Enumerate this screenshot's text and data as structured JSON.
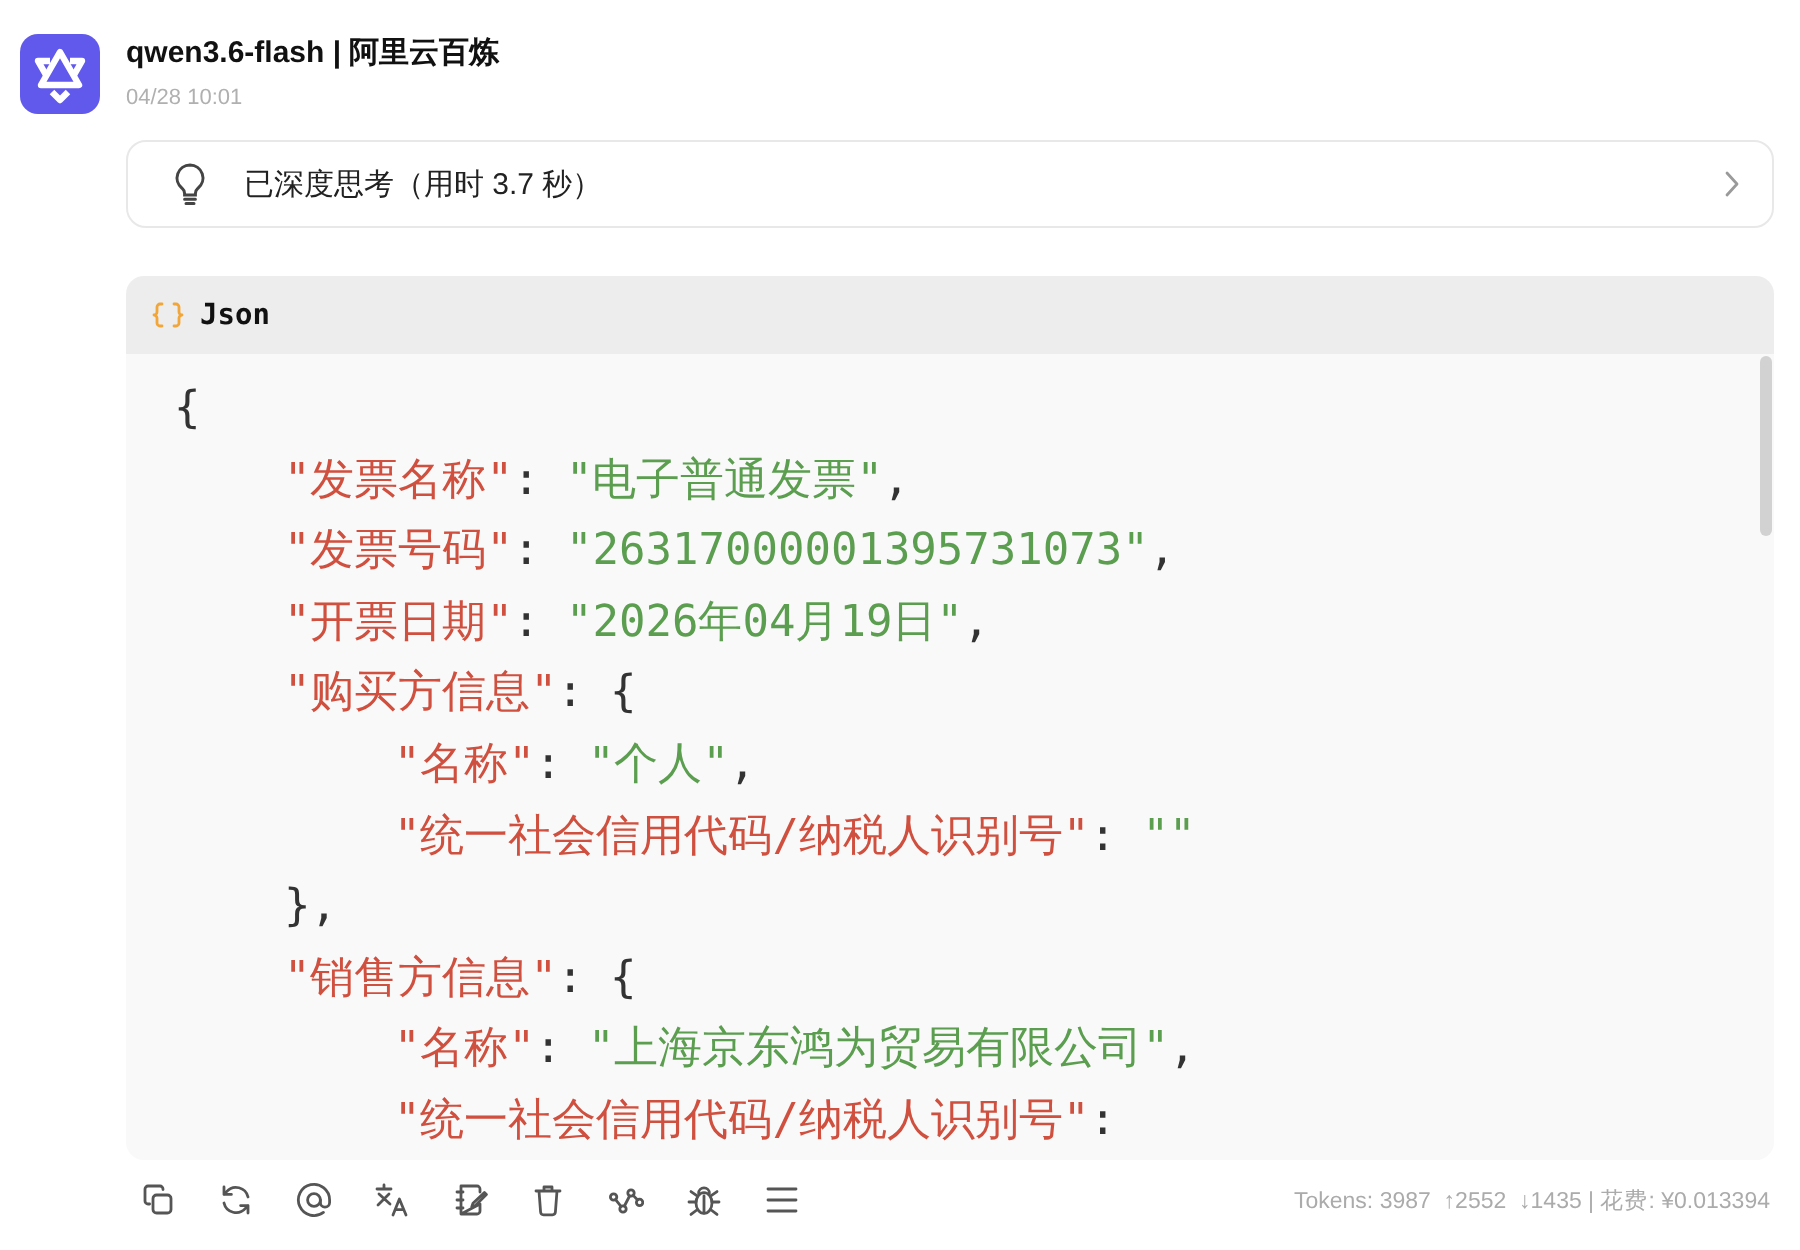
{
  "header": {
    "title": "qwen3.6-flash | 阿里云百炼",
    "time": "04/28 10:01"
  },
  "thinking": {
    "label": "已深度思考（用时 3.7 秒）",
    "expanded": false
  },
  "code_block": {
    "language": "Json",
    "lines": [
      {
        "tokens": [
          {
            "kind": "punct",
            "text": "{"
          }
        ],
        "children": [
          {
            "tokens": [
              {
                "kind": "key",
                "text": "\"发票名称\""
              },
              {
                "kind": "punct",
                "text": ": "
              },
              {
                "kind": "string",
                "text": "\"电子普通发票\""
              },
              {
                "kind": "punct",
                "text": ","
              }
            ]
          },
          {
            "tokens": [
              {
                "kind": "key",
                "text": "\"发票号码\""
              },
              {
                "kind": "punct",
                "text": ": "
              },
              {
                "kind": "string",
                "text": "\"26317000001395731073\""
              },
              {
                "kind": "punct",
                "text": ","
              }
            ]
          },
          {
            "tokens": [
              {
                "kind": "key",
                "text": "\"开票日期\""
              },
              {
                "kind": "punct",
                "text": ": "
              },
              {
                "kind": "string",
                "text": "\"2026年04月19日\""
              },
              {
                "kind": "punct",
                "text": ","
              }
            ]
          },
          {
            "tokens": [
              {
                "kind": "key",
                "text": "\"购买方信息\""
              },
              {
                "kind": "punct",
                "text": ": {"
              }
            ],
            "children": [
              {
                "tokens": [
                  {
                    "kind": "key",
                    "text": "\"名称\""
                  },
                  {
                    "kind": "punct",
                    "text": ": "
                  },
                  {
                    "kind": "string",
                    "text": "\"个人\""
                  },
                  {
                    "kind": "punct",
                    "text": ","
                  }
                ]
              },
              {
                "tokens": [
                  {
                    "kind": "key",
                    "text": "\"统一社会信用代码/纳税人识别号\""
                  },
                  {
                    "kind": "punct",
                    "text": ": "
                  },
                  {
                    "kind": "string",
                    "text": "\"\""
                  }
                ]
              }
            ]
          },
          {
            "tokens": [
              {
                "kind": "punct",
                "text": "},"
              }
            ]
          },
          {
            "tokens": [
              {
                "kind": "key",
                "text": "\"销售方信息\""
              },
              {
                "kind": "punct",
                "text": ": {"
              }
            ],
            "children": [
              {
                "tokens": [
                  {
                    "kind": "key",
                    "text": "\"名称\""
                  },
                  {
                    "kind": "punct",
                    "text": ": "
                  },
                  {
                    "kind": "string",
                    "text": "\"上海京东鸿为贸易有限公司\""
                  },
                  {
                    "kind": "punct",
                    "text": ","
                  }
                ]
              },
              {
                "tokens": [
                  {
                    "kind": "key",
                    "text": "\"统一社会信用代码/纳税人识别号\""
                  },
                  {
                    "kind": "punct",
                    "text": ":"
                  }
                ]
              }
            ]
          }
        ]
      }
    ]
  },
  "usage": "Tokens: 3987  ↑2552  ↓1435 | 花费: ¥0.013394"
}
